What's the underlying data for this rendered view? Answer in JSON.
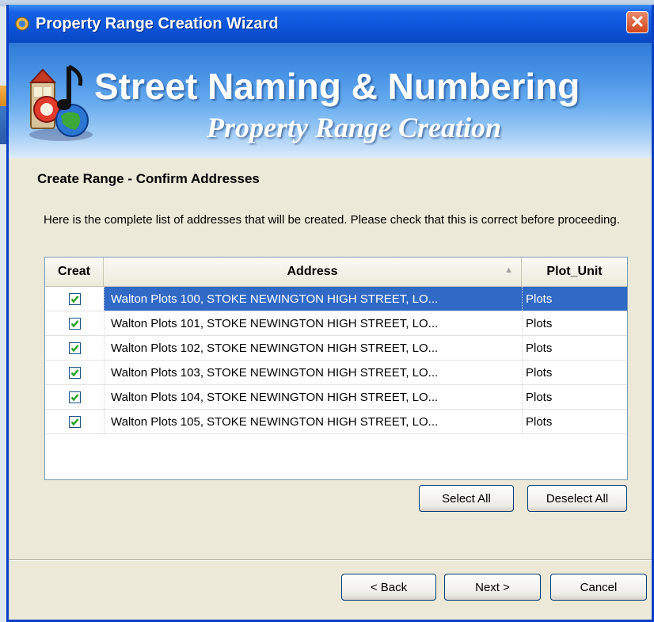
{
  "window": {
    "title": "Property Range Creation Wizard",
    "close_glyph": "✕"
  },
  "banner": {
    "title": "Street Naming & Numbering",
    "subtitle": "Property Range Creation"
  },
  "page": {
    "heading": "Create Range - Confirm Addresses",
    "description": "Here is the complete list of addresses that will be created. Please check that this is correct before proceeding."
  },
  "grid": {
    "columns": {
      "creat": "Creat",
      "address": "Address",
      "plot_unit": "Plot_Unit"
    },
    "rows": [
      {
        "checked": true,
        "address": "Walton Plots 100, STOKE NEWINGTON HIGH STREET, LO...",
        "plot_unit": "Plots",
        "selected": true
      },
      {
        "checked": true,
        "address": "Walton Plots 101, STOKE NEWINGTON HIGH STREET, LO...",
        "plot_unit": "Plots",
        "selected": false
      },
      {
        "checked": true,
        "address": "Walton Plots 102, STOKE NEWINGTON HIGH STREET, LO...",
        "plot_unit": "Plots",
        "selected": false
      },
      {
        "checked": true,
        "address": "Walton Plots 103, STOKE NEWINGTON HIGH STREET, LO...",
        "plot_unit": "Plots",
        "selected": false
      },
      {
        "checked": true,
        "address": "Walton Plots 104, STOKE NEWINGTON HIGH STREET, LO...",
        "plot_unit": "Plots",
        "selected": false
      },
      {
        "checked": true,
        "address": "Walton Plots 105, STOKE NEWINGTON HIGH STREET, LO...",
        "plot_unit": "Plots",
        "selected": false
      }
    ]
  },
  "buttons": {
    "select_all": "Select All",
    "deselect_all": "Deselect All",
    "back": "< Back",
    "next": "Next >",
    "cancel": "Cancel"
  },
  "colors": {
    "title_bar": "#0a55d9",
    "selection": "#316ac5",
    "checkmark": "#21a121"
  },
  "icons": {
    "title_icon": "wizard-app-icon",
    "logo": "street-naming-logo-icon",
    "sort": "sort-indicator-icon"
  }
}
